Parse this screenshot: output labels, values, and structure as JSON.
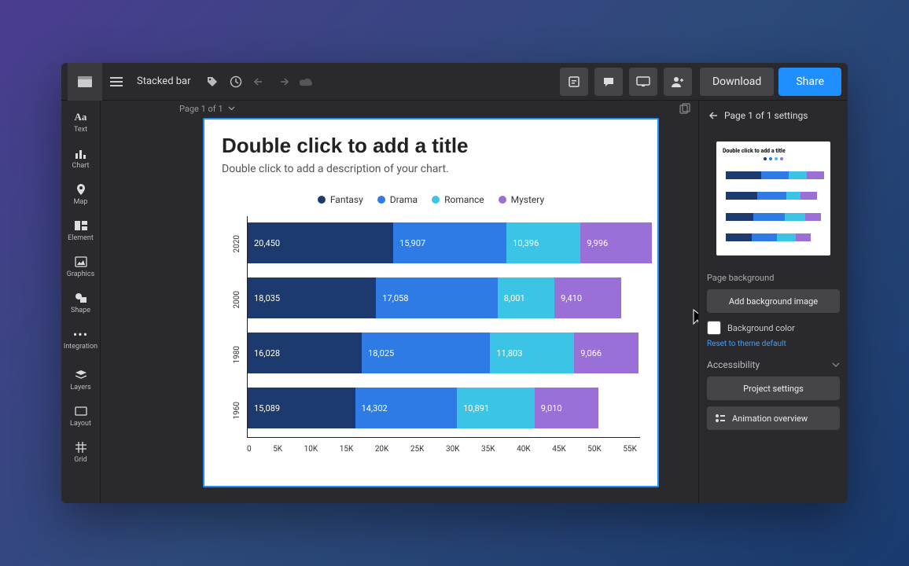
{
  "topbar": {
    "doc_title": "Stacked bar",
    "download": "Download",
    "share": "Share"
  },
  "page_strip": {
    "pager": "Page 1 of 1"
  },
  "sidebar": {
    "items": [
      {
        "label": "Text"
      },
      {
        "label": "Chart"
      },
      {
        "label": "Map"
      },
      {
        "label": "Element"
      },
      {
        "label": "Graphics"
      },
      {
        "label": "Shape"
      },
      {
        "label": "Integration"
      },
      {
        "label": "Layers"
      },
      {
        "label": "Layout"
      },
      {
        "label": "Grid"
      }
    ]
  },
  "page": {
    "title": "Double click to add a title",
    "description": "Double click to add a description of your chart."
  },
  "right_panel": {
    "header": "Page 1 of 1 settings",
    "page_background_label": "Page background",
    "add_bg_image": "Add background image",
    "bg_color_label": "Background color",
    "reset_link": "Reset to theme default",
    "accessibility": "Accessibility",
    "project_settings": "Project settings",
    "animation_overview": "Animation overview"
  },
  "colors": {
    "fantasy": "#1c3a6e",
    "drama": "#2f7be6",
    "romance": "#3bc4e6",
    "mystery": "#9b6fd8"
  },
  "chart_data": {
    "type": "bar",
    "orientation": "horizontal_stacked",
    "title": "Double click to add a title",
    "xlabel": "",
    "ylabel": "",
    "xlim": [
      0,
      55000
    ],
    "xticks": [
      "0",
      "5K",
      "10K",
      "15K",
      "20K",
      "25K",
      "30K",
      "35K",
      "40K",
      "45K",
      "50K",
      "55K"
    ],
    "categories": [
      "2020",
      "2000",
      "1980",
      "1960"
    ],
    "series": [
      {
        "name": "Fantasy",
        "values": [
          20450,
          18035,
          16028,
          15089
        ],
        "color": "#1c3a6e"
      },
      {
        "name": "Drama",
        "values": [
          15907,
          17058,
          18025,
          14302
        ],
        "color": "#2f7be6"
      },
      {
        "name": "Romance",
        "values": [
          10396,
          8001,
          11803,
          10891
        ],
        "color": "#3bc4e6"
      },
      {
        "name": "Mystery",
        "values": [
          9996,
          9410,
          9066,
          9010
        ],
        "color": "#9b6fd8"
      }
    ]
  }
}
